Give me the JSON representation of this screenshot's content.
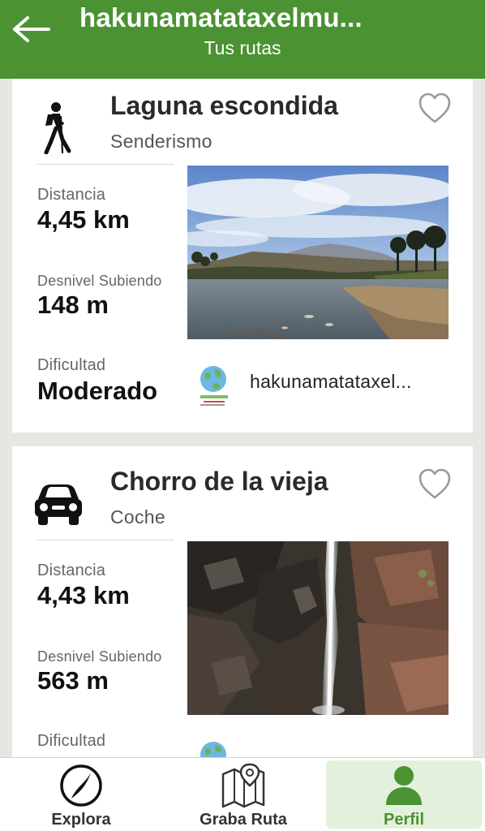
{
  "header": {
    "title": "hakunamatataxelmu...",
    "subtitle": "Tus rutas"
  },
  "routes": [
    {
      "title": "Laguna escondida",
      "activity": "Senderismo",
      "activity_icon": "hiker-icon",
      "distance_label": "Distancia",
      "distance_value": "4,45 km",
      "elevation_label": "Desnivel Subiendo",
      "elevation_value": "148 m",
      "difficulty_label": "Dificultad",
      "difficulty_value": "Moderado",
      "author": "hakunamatataxel...",
      "favorite": false
    },
    {
      "title": "Chorro de la vieja",
      "activity": "Coche",
      "activity_icon": "car-icon",
      "distance_label": "Distancia",
      "distance_value": "4,43 km",
      "elevation_label": "Desnivel Subiendo",
      "elevation_value": "563 m",
      "difficulty_label": "Dificultad",
      "difficulty_value": "",
      "author": "",
      "favorite": false
    }
  ],
  "tabs": [
    {
      "label": "Explora",
      "icon": "compass-icon",
      "active": false
    },
    {
      "label": "Graba Ruta",
      "icon": "map-pin-icon",
      "active": false
    },
    {
      "label": "Perfil",
      "icon": "profile-icon",
      "active": true
    }
  ],
  "colors": {
    "brand_green": "#4a9232",
    "active_tab_bg": "#e3f0dc",
    "background": "#e8e6e2"
  }
}
